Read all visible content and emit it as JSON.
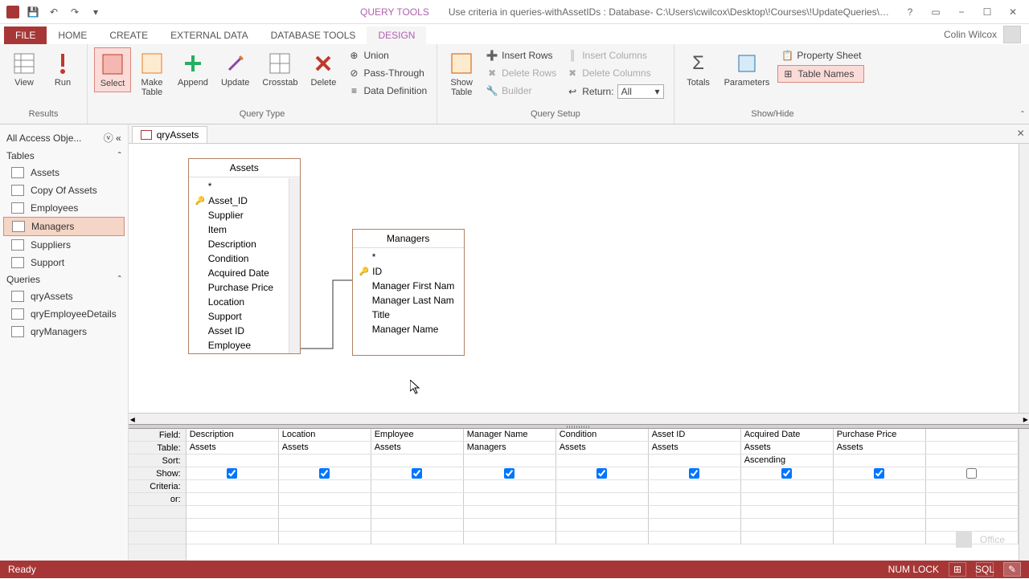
{
  "title": {
    "contextual": "QUERY TOOLS",
    "document": "Use criteria in queries-withAssetIDs : Database- C:\\Users\\cwilcox\\Desktop\\!Courses\\!UpdateQueries\\Use criteria in..."
  },
  "user": {
    "name": "Colin Wilcox"
  },
  "tabs": {
    "file": "FILE",
    "home": "HOME",
    "create": "CREATE",
    "external": "EXTERNAL DATA",
    "dbtools": "DATABASE TOOLS",
    "design": "DESIGN"
  },
  "ribbon": {
    "results": {
      "view": "View",
      "run": "Run",
      "group": "Results"
    },
    "querytype": {
      "select": "Select",
      "make": "Make\nTable",
      "append": "Append",
      "update": "Update",
      "crosstab": "Crosstab",
      "delete": "Delete",
      "union": "Union",
      "passthrough": "Pass-Through",
      "datadef": "Data Definition",
      "group": "Query Type"
    },
    "setup": {
      "showtable": "Show\nTable",
      "insertrows": "Insert Rows",
      "deleterows": "Delete Rows",
      "builder": "Builder",
      "insertcols": "Insert Columns",
      "deletecols": "Delete Columns",
      "return": "Return:",
      "returnval": "All",
      "group": "Query Setup"
    },
    "showhide": {
      "totals": "Totals",
      "params": "Parameters",
      "propsheet": "Property Sheet",
      "tablenames": "Table Names",
      "group": "Show/Hide"
    }
  },
  "nav": {
    "header": "All Access Obje...",
    "tables_header": "Tables",
    "queries_header": "Queries",
    "tables": [
      "Assets",
      "Copy Of Assets",
      "Employees",
      "Managers",
      "Suppliers",
      "Support"
    ],
    "queries": [
      "qryAssets",
      "qryEmployeeDetails",
      "qryManagers"
    ]
  },
  "doc_tab": {
    "name": "qryAssets"
  },
  "tables_diagram": {
    "assets": {
      "title": "Assets",
      "fields": [
        "*",
        "Asset_ID",
        "Supplier",
        "Item",
        "Description",
        "Condition",
        "Acquired Date",
        "Purchase Price",
        "Location",
        "Support",
        "Asset ID",
        "Employee"
      ],
      "key_index": 1
    },
    "managers": {
      "title": "Managers",
      "fields": [
        "*",
        "ID",
        "Manager First Nam",
        "Manager Last Nam",
        "Title",
        "Manager Name"
      ],
      "key_index": 1
    }
  },
  "qbe": {
    "labels": {
      "field": "Field:",
      "table": "Table:",
      "sort": "Sort:",
      "show": "Show:",
      "criteria": "Criteria:",
      "or": "or:"
    },
    "columns": [
      {
        "field": "Description",
        "table": "Assets",
        "sort": "",
        "show": true
      },
      {
        "field": "Location",
        "table": "Assets",
        "sort": "",
        "show": true
      },
      {
        "field": "Employee",
        "table": "Assets",
        "sort": "",
        "show": true
      },
      {
        "field": "Manager Name",
        "table": "Managers",
        "sort": "",
        "show": true
      },
      {
        "field": "Condition",
        "table": "Assets",
        "sort": "",
        "show": true
      },
      {
        "field": "Asset ID",
        "table": "Assets",
        "sort": "",
        "show": true
      },
      {
        "field": "Acquired Date",
        "table": "Assets",
        "sort": "Ascending",
        "show": true
      },
      {
        "field": "Purchase Price",
        "table": "Assets",
        "sort": "",
        "show": true
      }
    ]
  },
  "status": {
    "ready": "Ready",
    "numlock": "NUM LOCK",
    "office": "Office",
    "sql": "SQL"
  }
}
